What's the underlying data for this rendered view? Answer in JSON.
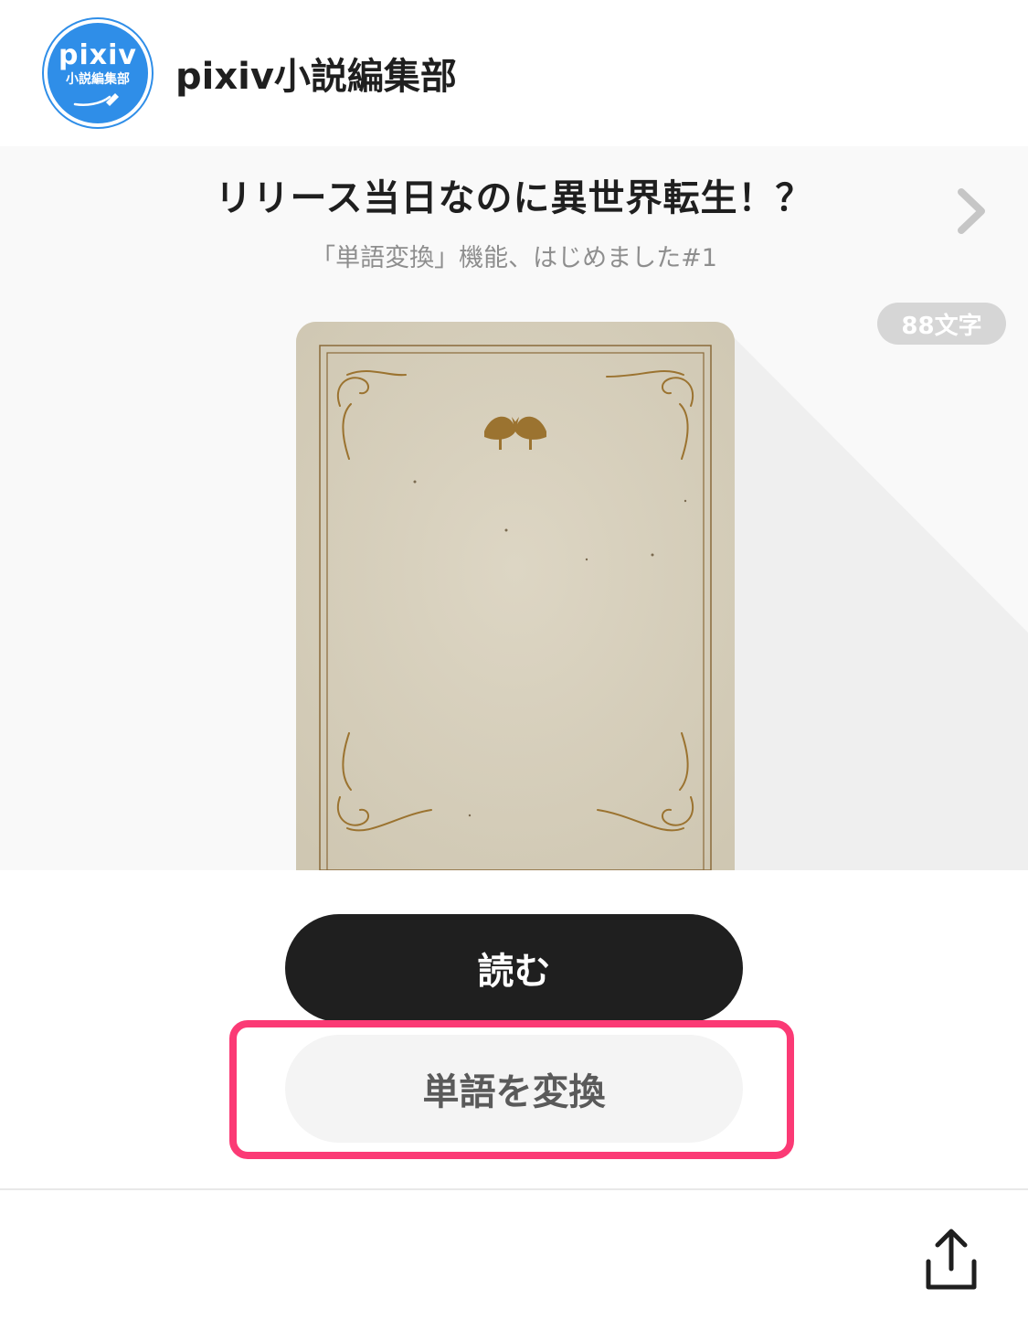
{
  "header": {
    "avatar_word": "pixiv",
    "avatar_sub": "小説編集部",
    "author_name": "pixiv小説編集部"
  },
  "work": {
    "title": "リリース当日なのに異世界転生！？",
    "subtitle": "「単語変換」機能、はじめました#1",
    "char_count": "88文字"
  },
  "actions": {
    "read_label": "読む",
    "convert_label": "単語を変換"
  },
  "colors": {
    "brand_blue": "#2f8ee8",
    "highlight": "#fb3a75",
    "primary_button": "#1f1f1f"
  },
  "icons": {
    "next": "chevron-right-icon",
    "share": "share-icon"
  }
}
